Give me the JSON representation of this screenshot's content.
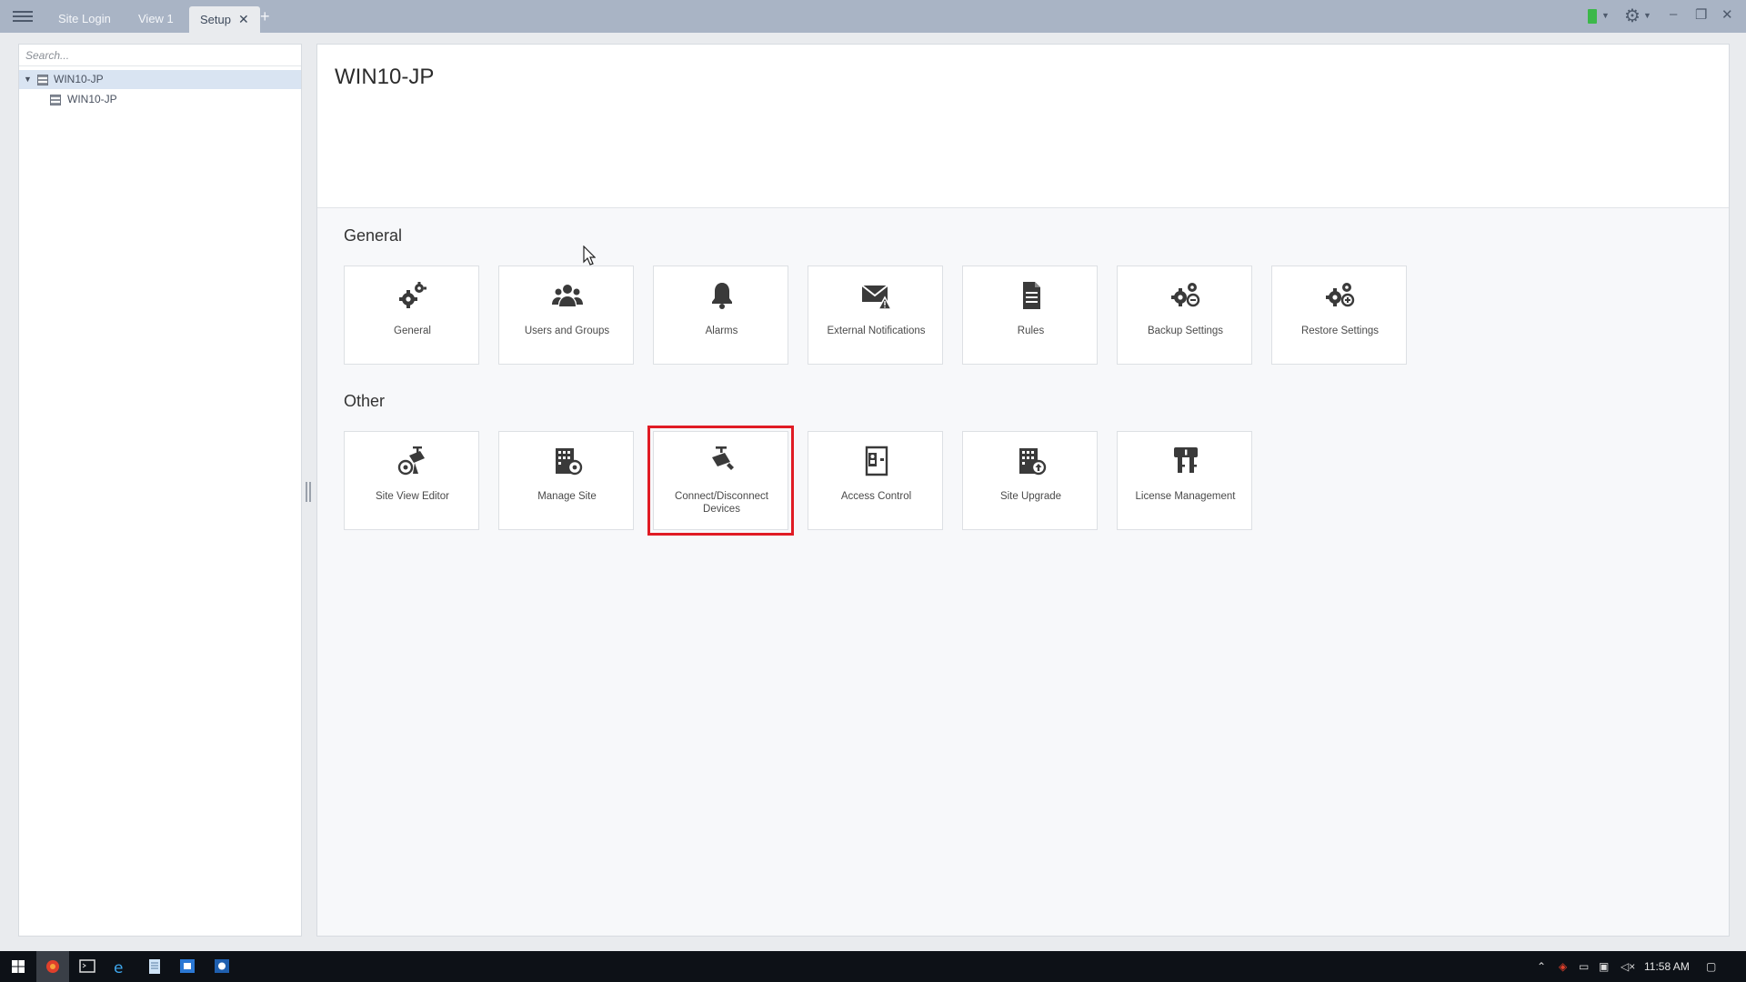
{
  "titlebar": {
    "tabs": [
      {
        "label": "Site Login"
      },
      {
        "label": "View 1"
      },
      {
        "label": "Setup"
      }
    ],
    "close_glyph": "✕",
    "add_glyph": "+",
    "controls": {
      "minimize": "–",
      "restore": "❐",
      "close": "✕"
    },
    "gear_glyph": "⚙",
    "status_color": "#3cb84a"
  },
  "left_panel": {
    "search_placeholder": "Search...",
    "tree": [
      {
        "label": "WIN10-JP",
        "selected": true
      },
      {
        "label": "WIN10-JP",
        "selected": false
      }
    ]
  },
  "main": {
    "title": "WIN10-JP",
    "sections": [
      {
        "title": "General",
        "tiles": [
          {
            "label": "General",
            "icon": "gears-icon"
          },
          {
            "label": "Users and Groups",
            "icon": "users-icon"
          },
          {
            "label": "Alarms",
            "icon": "bell-icon"
          },
          {
            "label": "External Notifications",
            "icon": "envelope-warning-icon"
          },
          {
            "label": "Rules",
            "icon": "document-icon"
          },
          {
            "label": "Backup Settings",
            "icon": "gear-backup-icon"
          },
          {
            "label": "Restore Settings",
            "icon": "gear-restore-icon"
          }
        ]
      },
      {
        "title": "Other",
        "tiles": [
          {
            "label": "Site View Editor",
            "icon": "camera-map-icon"
          },
          {
            "label": "Manage Site",
            "icon": "building-gear-icon"
          },
          {
            "label": "Connect/Disconnect Devices",
            "icon": "camera-connect-icon",
            "highlighted": true
          },
          {
            "label": "Access Control",
            "icon": "door-badge-icon"
          },
          {
            "label": "Site Upgrade",
            "icon": "building-upgrade-icon"
          },
          {
            "label": "License Management",
            "icon": "key-license-icon"
          }
        ]
      }
    ],
    "highlight_color": "#e01b24"
  },
  "taskbar": {
    "clock": "11:58 AM"
  }
}
